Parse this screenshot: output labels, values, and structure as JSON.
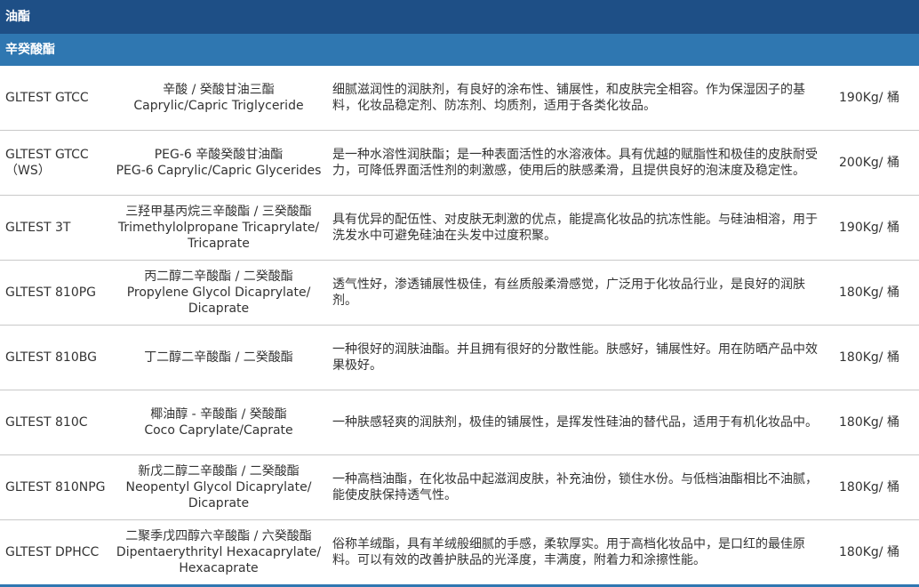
{
  "section_title": "油酯",
  "subsection_title": "辛癸酸酯",
  "rows": [
    {
      "code": "GLTEST GTCC",
      "name_cn": "辛酸 / 癸酸甘油三酯",
      "name_en": "Caprylic/Capric Triglyceride",
      "desc": "细腻滋润性的润肤剂，有良好的涂布性、铺展性，和皮肤完全相容。作为保湿因子的基料，化妆品稳定剂、防冻剂、均质剂，适用于各类化妆品。",
      "pack": "190Kg/ 桶"
    },
    {
      "code": "GLTEST GTCC （WS）",
      "name_cn": "PEG-6 辛酸癸酸甘油酯",
      "name_en": "PEG-6 Caprylic/Capric Glycerides",
      "desc": "是一种水溶性润肤酯；是一种表面活性的水溶液体。具有优越的赋脂性和极佳的皮肤耐受力，可降低界面活性剂的刺激感，使用后的肤感柔滑，且提供良好的泡沫度及稳定性。",
      "pack": "200Kg/ 桶"
    },
    {
      "code": "GLTEST 3T",
      "name_cn": "三羟甲基丙烷三辛酸酯 / 三癸酸酯",
      "name_en": "Trimethylolpropane Tricaprylate/ Tricaprate",
      "desc": "具有优异的配伍性、对皮肤无刺激的优点，能提高化妆品的抗冻性能。与硅油相溶，用于洗发水中可避免硅油在头发中过度积聚。",
      "pack": "190Kg/ 桶"
    },
    {
      "code": "GLTEST 810PG",
      "name_cn": "丙二醇二辛酸酯 / 二癸酸酯",
      "name_en": "Propylene Glycol Dicaprylate/ Dicaprate",
      "desc": "透气性好，渗透铺展性极佳，有丝质般柔滑感觉，广泛用于化妆品行业，是良好的润肤剂。",
      "pack": "180Kg/ 桶"
    },
    {
      "code": "GLTEST 810BG",
      "name_cn": "丁二醇二辛酸酯 / 二癸酸酯",
      "name_en": "",
      "desc": "一种很好的润肤油酯。并且拥有很好的分散性能。肤感好，铺展性好。用在防晒产品中效果极好。",
      "pack": "180Kg/ 桶"
    },
    {
      "code": "GLTEST 810C",
      "name_cn": "椰油醇 - 辛酸酯 / 癸酸酯",
      "name_en": "Coco Caprylate/Caprate",
      "desc": "一种肤感轻爽的润肤剂，极佳的铺展性，是挥发性硅油的替代品，适用于有机化妆品中。",
      "pack": "180Kg/ 桶"
    },
    {
      "code": "GLTEST 810NPG",
      "name_cn": "新戊二醇二辛酸酯 / 二癸酸酯",
      "name_en": "Neopentyl Glycol Dicaprylate/ Dicaprate",
      "desc": "一种高档油酯，在化妆品中起滋润皮肤，补充油份，锁住水份。与低档油酯相比不油腻，能使皮肤保持透气性。",
      "pack": "180Kg/ 桶"
    },
    {
      "code": "GLTEST DPHCC",
      "name_cn": "二聚季戊四醇六辛酸酯 / 六癸酸酯",
      "name_en": "Dipentaerythrityl Hexacaprylate/ Hexacaprate",
      "desc": "俗称羊绒酯，具有羊绒般细腻的手感，柔软厚实。用于高档化妆品中，是口红的最佳原料。可以有效的改善护肤品的光泽度，丰满度，附着力和涂擦性能。",
      "pack": "180Kg/ 桶"
    }
  ]
}
